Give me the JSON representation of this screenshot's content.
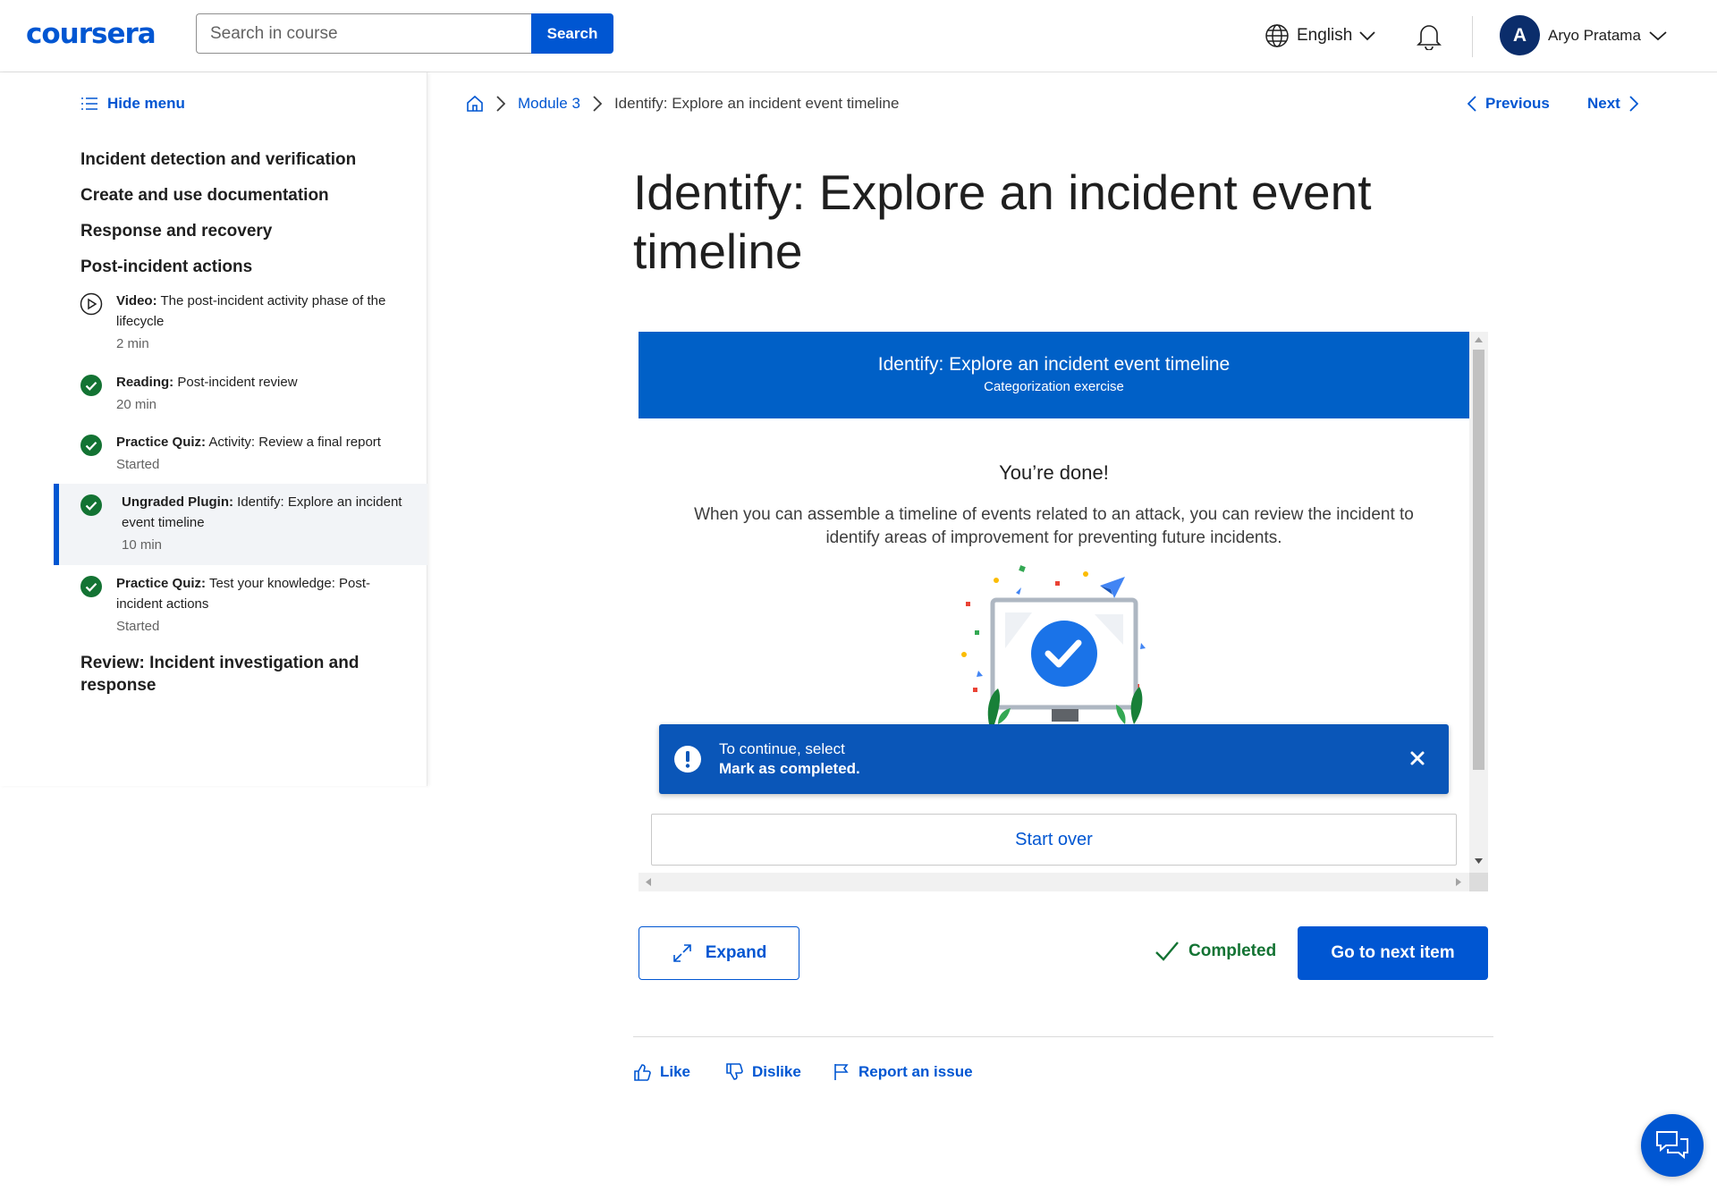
{
  "header": {
    "logo": "coursera",
    "search_placeholder": "Search in course",
    "search_button": "Search",
    "language": "English",
    "user_initial": "A",
    "user_name": "Aryo Pratama"
  },
  "sidebar": {
    "hide_menu": "Hide menu",
    "modules_top": [
      "Incident detection and verification",
      "Create and use documentation",
      "Response and recovery",
      "Post-incident actions"
    ],
    "items": [
      {
        "type": "Video:",
        "title": "The post-incident activity phase of the lifecycle",
        "meta": "2 min",
        "status": "video"
      },
      {
        "type": "Reading:",
        "title": "Post-incident review",
        "meta": "20 min",
        "status": "completed"
      },
      {
        "type": "Practice Quiz:",
        "title": "Activity: Review a final report",
        "meta": "Started",
        "status": "completed"
      },
      {
        "type": "Ungraded Plugin:",
        "title": "Identify: Explore an incident event timeline",
        "meta": "10 min",
        "status": "completed"
      },
      {
        "type": "Practice Quiz:",
        "title": "Test your knowledge: Post-incident actions",
        "meta": "Started",
        "status": "completed"
      }
    ],
    "module_bottom": "Review: Incident investigation and response"
  },
  "breadcrumb": {
    "module": "Module 3",
    "current": "Identify: Explore an incident event timeline"
  },
  "nav": {
    "previous": "Previous",
    "next": "Next"
  },
  "page_title": "Identify: Explore an incident event timeline",
  "plugin": {
    "header_title": "Identify: Explore an incident event timeline",
    "header_subtitle": "Categorization exercise",
    "done_title": "You’re done!",
    "done_text": "When you can assemble a timeline of events related to an attack, you can review the incident to identify areas of improvement for preventing future incidents.",
    "toast_line1": "To continue, select",
    "toast_line2": "Mark as completed.",
    "start_over": "Start over"
  },
  "actions": {
    "expand": "Expand",
    "completed": "Completed",
    "next_item": "Go to next item"
  },
  "feedback": {
    "like": "Like",
    "dislike": "Dislike",
    "report": "Report an issue"
  },
  "colors": {
    "brand": "#0056d2",
    "success": "#137333",
    "plugin_header": "#0060c7"
  }
}
